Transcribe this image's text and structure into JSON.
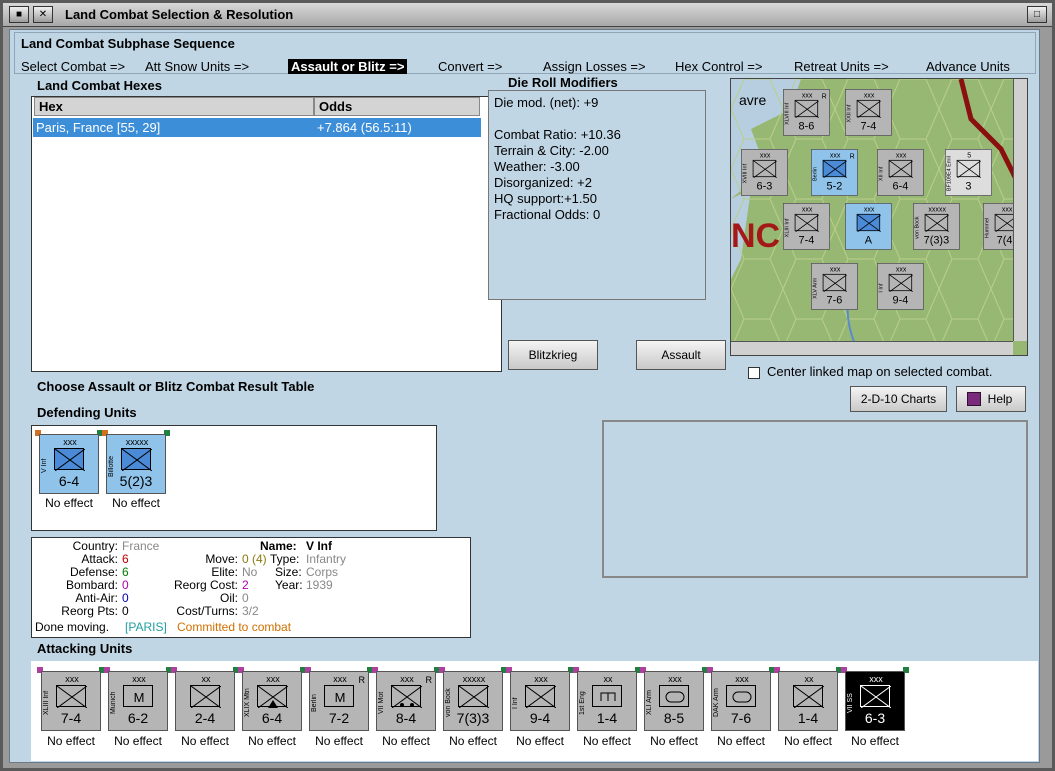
{
  "window": {
    "title": "Land Combat Selection & Resolution"
  },
  "subphase": {
    "title": "Land Combat Subphase Sequence",
    "steps": [
      "Select Combat =>",
      "Att Snow Units =>",
      "Assault or Blitz =>",
      "Convert =>",
      "Assign Losses =>",
      "Hex Control =>",
      "Retreat Units =>",
      "Advance Units"
    ]
  },
  "hexes": {
    "title": "Land Combat Hexes",
    "col_hex": "Hex",
    "col_odds": "Odds",
    "rows": [
      {
        "hex": "Paris, France [55, 29]",
        "odds": "+7.864 (56.5:11)"
      }
    ]
  },
  "drm": {
    "title": "Die Roll Modifiers",
    "net": "Die mod. (net): +9",
    "lines": [
      "Combat Ratio: +10.36",
      "Terrain & City: -2.00",
      "Weather: -3.00",
      "Disorganized: +2",
      "HQ support:+1.50",
      "Fractional Odds: 0"
    ]
  },
  "map": {
    "map_label": "NC",
    "city_label": "avre",
    "counters": [
      {
        "top": "xxx",
        "str": "8-6",
        "side": "XLVIII Inf",
        "r": "R"
      },
      {
        "top": "xxx",
        "str": "7-4",
        "side": "XXII Inf"
      },
      {
        "top": "xxx",
        "str": "6-3",
        "side": "XVIII Inf"
      },
      {
        "top": "xxx",
        "str": "5-2",
        "side": "Berlin",
        "r": "R"
      },
      {
        "top": "xxx",
        "str": "6-4",
        "side": "XII Inf"
      },
      {
        "top": "5",
        "str": "3",
        "side": "BF109E4 Emil"
      },
      {
        "top": "xxx",
        "str": "7-4",
        "side": "XLIII Inf"
      },
      {
        "top": "xxx",
        "str": "A",
        "side": ""
      },
      {
        "top": "xxxxx",
        "str": "7(3)3",
        "side": "von Bock"
      },
      {
        "top": "xxx",
        "str": "7(4)",
        "side": "Hummel"
      },
      {
        "top": "xxx",
        "str": "7-6",
        "side": "XLV Arm"
      },
      {
        "top": "xxx",
        "str": "9-4",
        "side": "I Inf"
      }
    ]
  },
  "buttons": {
    "blitz": "Blitzkrieg",
    "assault": "Assault",
    "charts": "2-D-10 Charts",
    "help": "Help",
    "center": "Center linked map on selected combat."
  },
  "choose_label": "Choose Assault or Blitz Combat Result Table",
  "defending": {
    "title": "Defending Units",
    "units": [
      {
        "top": "xxx",
        "str": "6-4",
        "side": "V Inf",
        "result": "No effect"
      },
      {
        "top": "xxxxx",
        "str": "5(2)3",
        "side": "Billotte",
        "result": "No effect"
      }
    ]
  },
  "details": {
    "country_k": "Country:",
    "country_v": "France",
    "attack_k": "Attack:",
    "attack_v": "6",
    "defense_k": "Defense:",
    "defense_v": "6",
    "bombard_k": "Bombard:",
    "bombard_v": "0",
    "aa_k": "Anti-Air:",
    "aa_v": "0",
    "reorg_k": "Reorg Pts:",
    "reorg_v": "0",
    "name_k": "Name:",
    "name_v": "V Inf",
    "move_k": "Move:",
    "move_v": "0 (4)",
    "type_k": "Type:",
    "type_v": "Infantry",
    "elite_k": "Elite:",
    "elite_v": "No",
    "size_k": "Size:",
    "size_v": "Corps",
    "reorgcost_k": "Reorg Cost:",
    "reorgcost_v": "2",
    "year_k": "Year:",
    "year_v": "1939",
    "oil_k": "Oil:",
    "oil_v": "0",
    "cost_k": "Cost/Turns:",
    "cost_v": "3/2",
    "status1": "Done moving.",
    "status2": "[PARIS]",
    "status3": "Committed to combat"
  },
  "attacking": {
    "title": "Attacking Units",
    "units": [
      {
        "top": "xxx",
        "str": "7-4",
        "side": "XLIII Inf",
        "result": "No effect",
        "sym": "inf"
      },
      {
        "top": "xxx",
        "str": "6-2",
        "side": "Munich",
        "result": "No effect",
        "sym": "m"
      },
      {
        "top": "xx",
        "str": "2-4",
        "side": "",
        "result": "No effect",
        "sym": "inf2"
      },
      {
        "top": "xxx",
        "str": "6-4",
        "side": "XLIX Mtn",
        "result": "No effect",
        "sym": "mtn"
      },
      {
        "top": "xxx",
        "str": "7-2",
        "side": "Berlin",
        "result": "No effect",
        "sym": "m",
        "r": "R"
      },
      {
        "top": "xxx",
        "str": "8-4",
        "side": "VII Mot",
        "result": "No effect",
        "sym": "mot",
        "r": "R"
      },
      {
        "top": "xxxxx",
        "str": "7(3)3",
        "side": "von Bock",
        "result": "No effect",
        "sym": "inf"
      },
      {
        "top": "xxx",
        "str": "9-4",
        "side": "I Inf",
        "result": "No effect",
        "sym": "inf"
      },
      {
        "top": "xx",
        "str": "1-4",
        "side": "1st Eng",
        "result": "No effect",
        "sym": "eng"
      },
      {
        "top": "xxx",
        "str": "8-5",
        "side": "XLI Arm",
        "result": "No effect",
        "sym": "arm"
      },
      {
        "top": "xxx",
        "str": "7-6",
        "side": "DAK Arm",
        "result": "No effect",
        "sym": "arm"
      },
      {
        "top": "xx",
        "str": "1-4",
        "side": "",
        "result": "No effect",
        "sym": "inf"
      },
      {
        "top": "xxx",
        "str": "6-3",
        "side": "VII SS",
        "result": "No effect",
        "sym": "ss"
      }
    ]
  },
  "colors": {
    "german": "#b5b5b5",
    "french": "#8fc3ea",
    "ss": "#000000",
    "selection": "#3c8ed8"
  }
}
